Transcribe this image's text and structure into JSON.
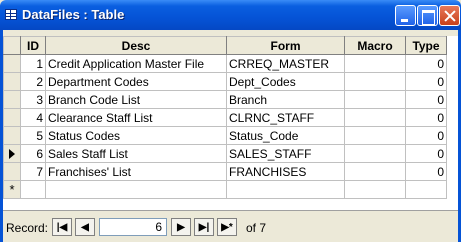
{
  "window": {
    "title": "DataFiles : Table"
  },
  "columns": [
    "ID",
    "Desc",
    "Form",
    "Macro",
    "Type"
  ],
  "rows": [
    {
      "id": "1",
      "desc": "Credit Application Master File",
      "form": "CRREQ_MASTER",
      "macro": "",
      "type": "0"
    },
    {
      "id": "2",
      "desc": "Department Codes",
      "form": "Dept_Codes",
      "macro": "",
      "type": "0"
    },
    {
      "id": "3",
      "desc": "Branch Code List",
      "form": "Branch",
      "macro": "",
      "type": "0"
    },
    {
      "id": "4",
      "desc": "Clearance Staff List",
      "form": "CLRNC_STAFF",
      "macro": "",
      "type": "0"
    },
    {
      "id": "5",
      "desc": "Status Codes",
      "form": "Status_Code",
      "macro": "",
      "type": "0"
    },
    {
      "id": "6",
      "desc": "Sales Staff List",
      "form": "SALES_STAFF",
      "macro": "",
      "type": "0"
    },
    {
      "id": "7",
      "desc": "Franchises' List",
      "form": "FRANCHISES",
      "macro": "",
      "type": "0"
    }
  ],
  "new_row_marker": "*",
  "current_row_index": 5,
  "navigator": {
    "label": "Record:",
    "first": "|◀",
    "prev": "◀",
    "current": "6",
    "next": "▶",
    "last": "▶|",
    "new": "▶*",
    "total_text": "of 7"
  },
  "icons": {
    "title": "table-icon",
    "minimize": "minimize-icon",
    "maximize": "maximize-icon",
    "close": "close-icon",
    "row_pointer": "row-pointer-icon"
  },
  "colors": {
    "titlebar": "#0553d6",
    "close_button": "#c8411b",
    "window_face": "#ece9d8"
  }
}
